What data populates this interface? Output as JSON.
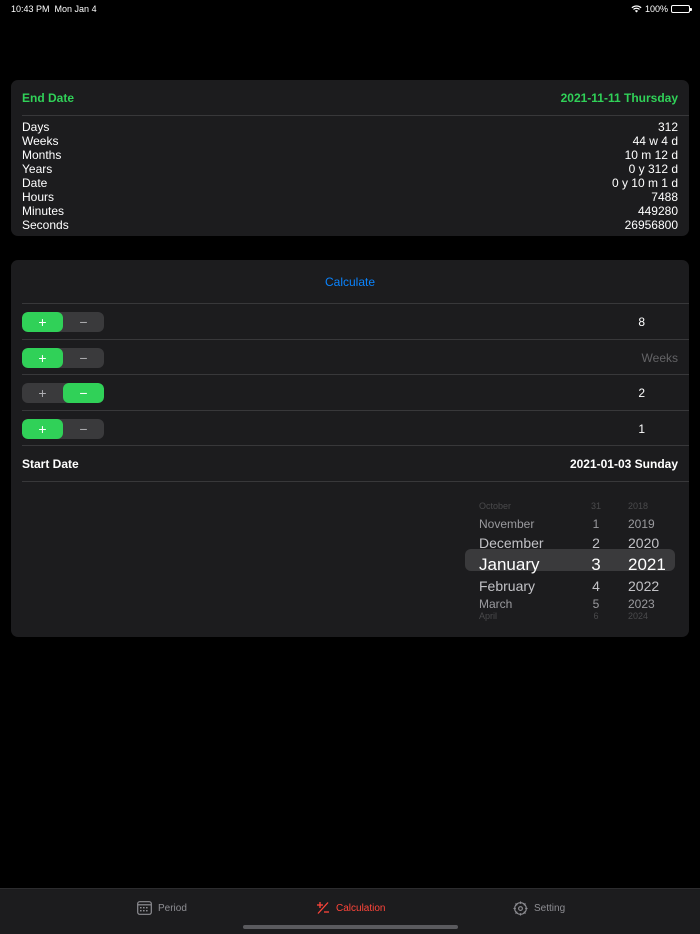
{
  "status": {
    "time": "10:43 PM",
    "date": "Mon Jan 4",
    "battery": "100%"
  },
  "end_date": {
    "label": "End Date",
    "value": "2021-11-11 Thursday",
    "stats": [
      {
        "label": "Days",
        "value": "312"
      },
      {
        "label": "Weeks",
        "value": "44 w 4 d"
      },
      {
        "label": "Months",
        "value": "10 m 12 d"
      },
      {
        "label": "Years",
        "value": "0 y 312 d"
      },
      {
        "label": "Date",
        "value": "0 y 10 m 1 d"
      },
      {
        "label": "Hours",
        "value": "7488"
      },
      {
        "label": "Minutes",
        "value": "449280"
      },
      {
        "label": "Seconds",
        "value": "26956800"
      }
    ]
  },
  "calc": {
    "button": "Calculate",
    "rows": [
      {
        "plus": "+",
        "minus": "−",
        "active": "plus",
        "value": "8"
      },
      {
        "plus": "+",
        "minus": "−",
        "active": "plus",
        "value": "Weeks"
      },
      {
        "plus": "+",
        "minus": "−",
        "active": "minus",
        "value": "2"
      },
      {
        "plus": "+",
        "minus": "−",
        "active": "plus",
        "value": "1"
      }
    ],
    "start_label": "Start Date",
    "start_value": "2021-01-03 Sunday"
  },
  "picker": {
    "months": [
      "October",
      "November",
      "December",
      "January",
      "February",
      "March",
      "April"
    ],
    "days": [
      "31",
      "1",
      "2",
      "3",
      "4",
      "5",
      "6"
    ],
    "years": [
      "2018",
      "2019",
      "2020",
      "2021",
      "2022",
      "2023",
      "2024"
    ],
    "selected_index": 3
  },
  "tabs": [
    {
      "label": "Period",
      "icon": "calendar-icon"
    },
    {
      "label": "Calculation",
      "icon": "plus-minus-icon"
    },
    {
      "label": "Setting",
      "icon": "gear-icon"
    }
  ],
  "colors": {
    "accent_green": "#30d158",
    "link_blue": "#0a84ff",
    "active_tab": "#ff453a"
  }
}
